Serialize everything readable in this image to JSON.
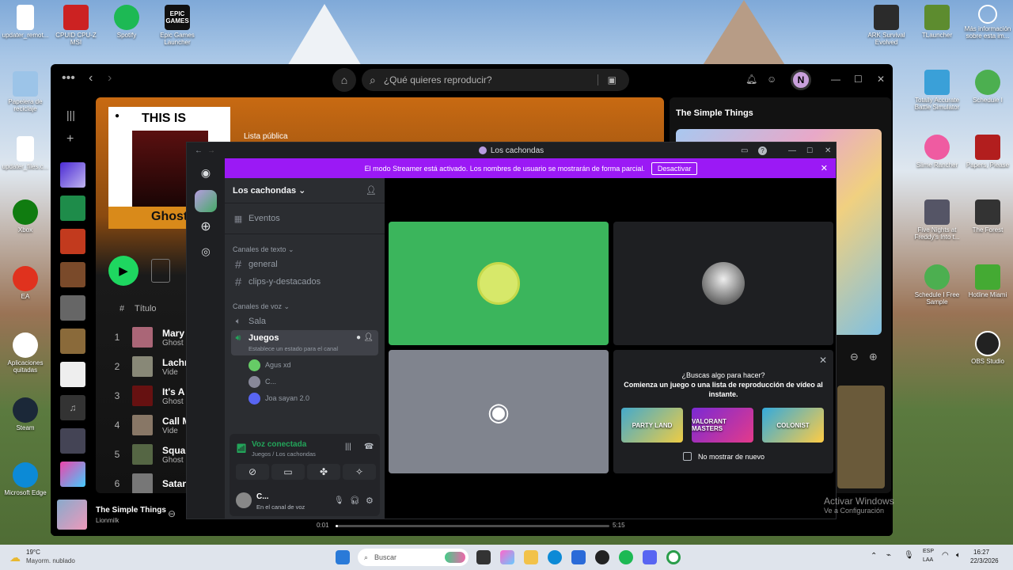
{
  "desktop_icons": {
    "updater_remote": "updater_remot...",
    "cpuid": "CPUID CPU-Z MSI",
    "spotify": "Spotify",
    "epic": "Epic Games Launcher",
    "recycle": "Papelera de reciclaje",
    "updater_files": "updater_files.c...",
    "xbox": "Xbox",
    "ea": "EA",
    "apps": "Aplicaciones quitadas",
    "steam": "Steam",
    "edge": "Microsoft Edge",
    "ark": "ARK Survival Evolved",
    "tlauncher": "TLauncher",
    "mas_info": "Más información sobre esta im...",
    "totally": "Totally Accurate Battle Simulator",
    "schedule": "Schedule I",
    "slime": "Slime Rancher",
    "papers": "Papers, Please",
    "fnaf": "Five Nights at Freddy's Into t...",
    "forest": "The Forest",
    "schedule_free": "Schedule I Free Sample",
    "hotline": "Hotline Miami",
    "obs": "OBS Studio",
    "epic_logo": "EPIC GAMES"
  },
  "spotify": {
    "search_placeholder": "¿Qué quieres reproducir?",
    "avatar": "N",
    "playlist_label": "Lista pública",
    "cover_title": "THIS IS",
    "cover_artist": "Ghost",
    "col_title": "Título",
    "tracks": [
      {
        "n": "1",
        "title": "Mary O",
        "sub": "Ghost"
      },
      {
        "n": "2",
        "title": "Lachry",
        "sub": "Vide"
      },
      {
        "n": "3",
        "title": "It's A S",
        "sub": "Ghost"
      },
      {
        "n": "4",
        "title": "Call M",
        "sub": "Vide"
      },
      {
        "n": "5",
        "title": "Square",
        "sub": "Ghost"
      },
      {
        "n": "6",
        "title": "Satani",
        "sub": ""
      }
    ],
    "now_playing": {
      "title": "The Simple Things",
      "artist": "Lionmilk"
    },
    "right_title": "The Simple Things",
    "time_elapsed": "0:01",
    "time_total": "5:15",
    "progress": 0.01
  },
  "discord": {
    "title": "Los cachondas",
    "banner_text": "El modo Streamer está activado. Los nombres de usuario se mostrarán de forma parcial.",
    "banner_button": "Desactivar",
    "server_name": "Los cachondas",
    "events": "Eventos",
    "text_category": "Canales de texto",
    "text_channels": [
      "general",
      "clips-y-destacados"
    ],
    "voice_category": "Canales de voz",
    "voice_channels": [
      "Sala",
      "Juegos"
    ],
    "juegos_status": "Establece un estado para el canal",
    "members": [
      "Agus xd",
      "C...",
      "Joa sayan 2.0"
    ],
    "voice_connected": "Voz conectada",
    "voice_path": "Juegos / Los cachondas",
    "user_name": "C...",
    "user_status": "En el canal de voz",
    "activity_title": "¿Buscas algo para hacer?",
    "activity_sub": "Comienza un juego o una lista de reproducción de vídeo al instante.",
    "activities": [
      "PARTY LAND",
      "VALORANT MASTERS",
      "COLONIST"
    ],
    "no_show": "No mostrar de nuevo"
  },
  "watermark": {
    "line1": "Activar Windows",
    "line2": "Ve a Configuración"
  },
  "taskbar": {
    "temp": "19°C",
    "weather": "Mayorm. nublado",
    "search": "Buscar",
    "lang1": "ESP",
    "lang2": "LAA",
    "time": "16:27",
    "date": "22/3/2026"
  }
}
